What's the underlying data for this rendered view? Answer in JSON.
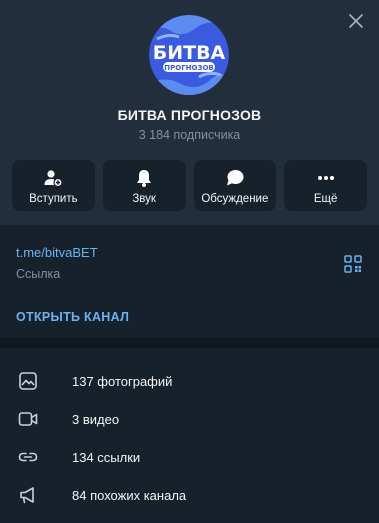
{
  "channel": {
    "avatar_text_main": "БИТВА",
    "avatar_text_sub": "ПРОГНОЗОВ",
    "title": "БИТВА ПРОГНОЗОВ",
    "subscribers": "3 184 подписчика"
  },
  "actions": [
    {
      "label": "Вступить",
      "icon": "join-icon"
    },
    {
      "label": "Звук",
      "icon": "bell-icon"
    },
    {
      "label": "Обсуждение",
      "icon": "chat-bubble-icon"
    },
    {
      "label": "Ещё",
      "icon": "more-dots-icon"
    }
  ],
  "info": {
    "link": "t.me/bitvaBET",
    "link_caption": "Ссылка",
    "open_channel": "ОТКРЫТЬ КАНАЛ"
  },
  "media": [
    {
      "label": "137 фотографий",
      "icon": "photo-icon"
    },
    {
      "label": "3 видео",
      "icon": "video-icon"
    },
    {
      "label": "134 ссылки",
      "icon": "link-icon"
    },
    {
      "label": "84 похожих канала",
      "icon": "megaphone-icon"
    }
  ],
  "colors": {
    "background": "#17212b",
    "header": "#232e3c",
    "accent": "#6ab3f3",
    "muted": "#7f91a4",
    "avatar_bg": "#3a5be0"
  }
}
